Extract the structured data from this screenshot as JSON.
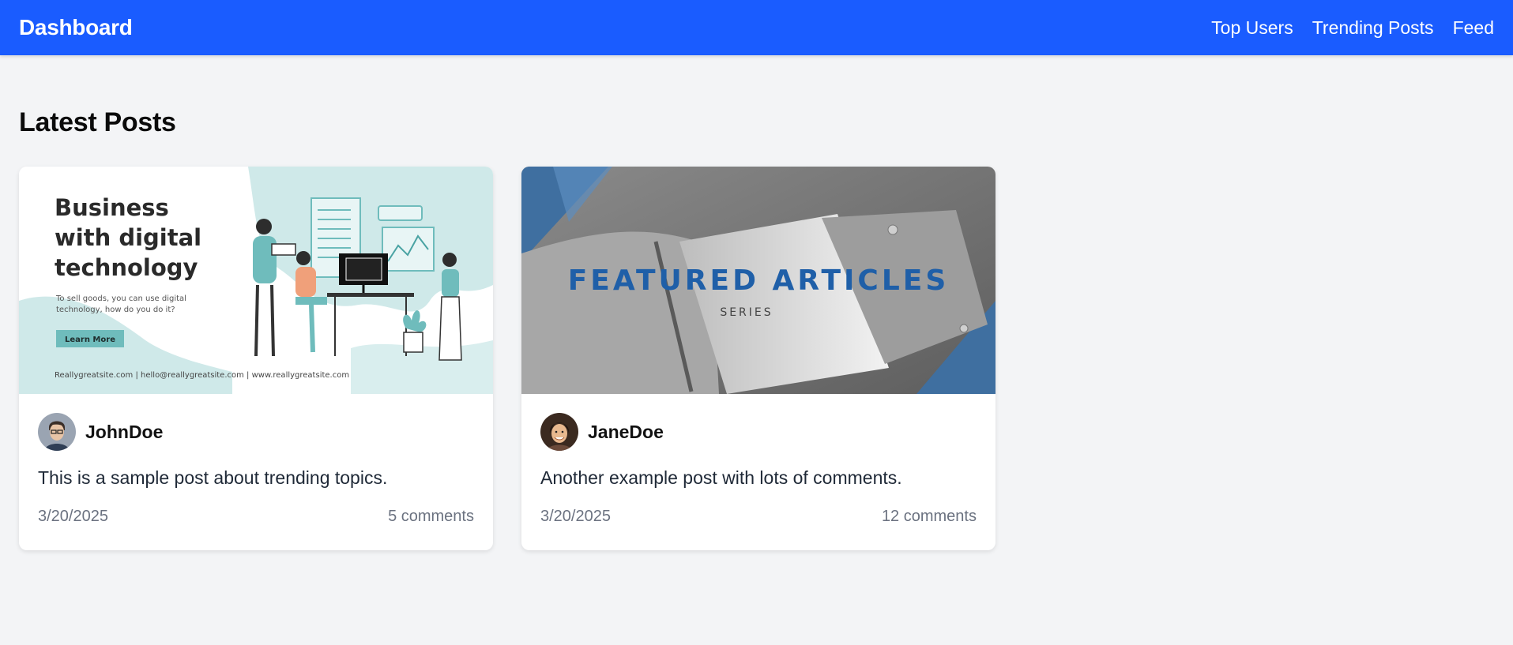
{
  "navbar": {
    "brand": "Dashboard",
    "links": [
      "Top Users",
      "Trending Posts",
      "Feed"
    ]
  },
  "section_title": "Latest Posts",
  "posts": [
    {
      "image": {
        "heading_lines": [
          "Business",
          "with digital",
          "technology"
        ],
        "subtext_lines": [
          "To sell goods, you can use digital",
          "technology, how do you do it?"
        ],
        "button": "Learn More",
        "footer": "Reallygreatsite.com | hello@reallygreatsite.com | www.reallygreatsite.com"
      },
      "author": "JohnDoe",
      "text": "This is a sample post about trending topics.",
      "date": "3/20/2025",
      "comments": "5 comments"
    },
    {
      "image": {
        "title": "FEATURED ARTICLES",
        "subtitle": "SERIES"
      },
      "author": "JaneDoe",
      "text": "Another example post with lots of comments.",
      "date": "3/20/2025",
      "comments": "12 comments"
    }
  ],
  "colors": {
    "navbar": "#1a5cff",
    "background": "#f3f4f6",
    "teal_accent": "#7cc4c4",
    "featured_blue": "#1f5fa8"
  }
}
